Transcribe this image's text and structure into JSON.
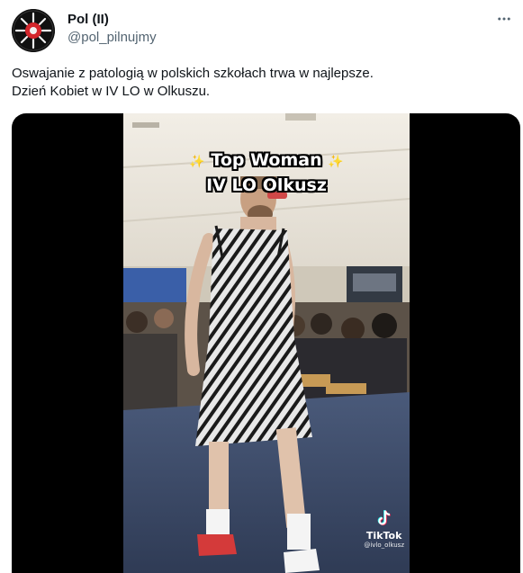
{
  "author": {
    "display_name": "Pol (II)",
    "handle": "@pol_pilnujmy"
  },
  "tweet": {
    "text_lines": [
      "Oswajanie z patologią w polskich szkołach trwa w najlepsze.",
      "Dzień Kobiet w IV LO w Olkuszu."
    ]
  },
  "media": {
    "caption_line_1": "Top Woman",
    "caption_line_2": "IV LO Olkusz",
    "sparkle": "✨",
    "tiktok_brand": "TikTok",
    "tiktok_user": "@ivlo_olkusz"
  },
  "icons": {
    "more": "more-horizontal-icon",
    "tiktok": "tiktok-logo-icon",
    "avatar": "avatar-emblem"
  },
  "colors": {
    "text_primary": "#0f1419",
    "text_secondary": "#536471",
    "media_background": "#000000"
  }
}
